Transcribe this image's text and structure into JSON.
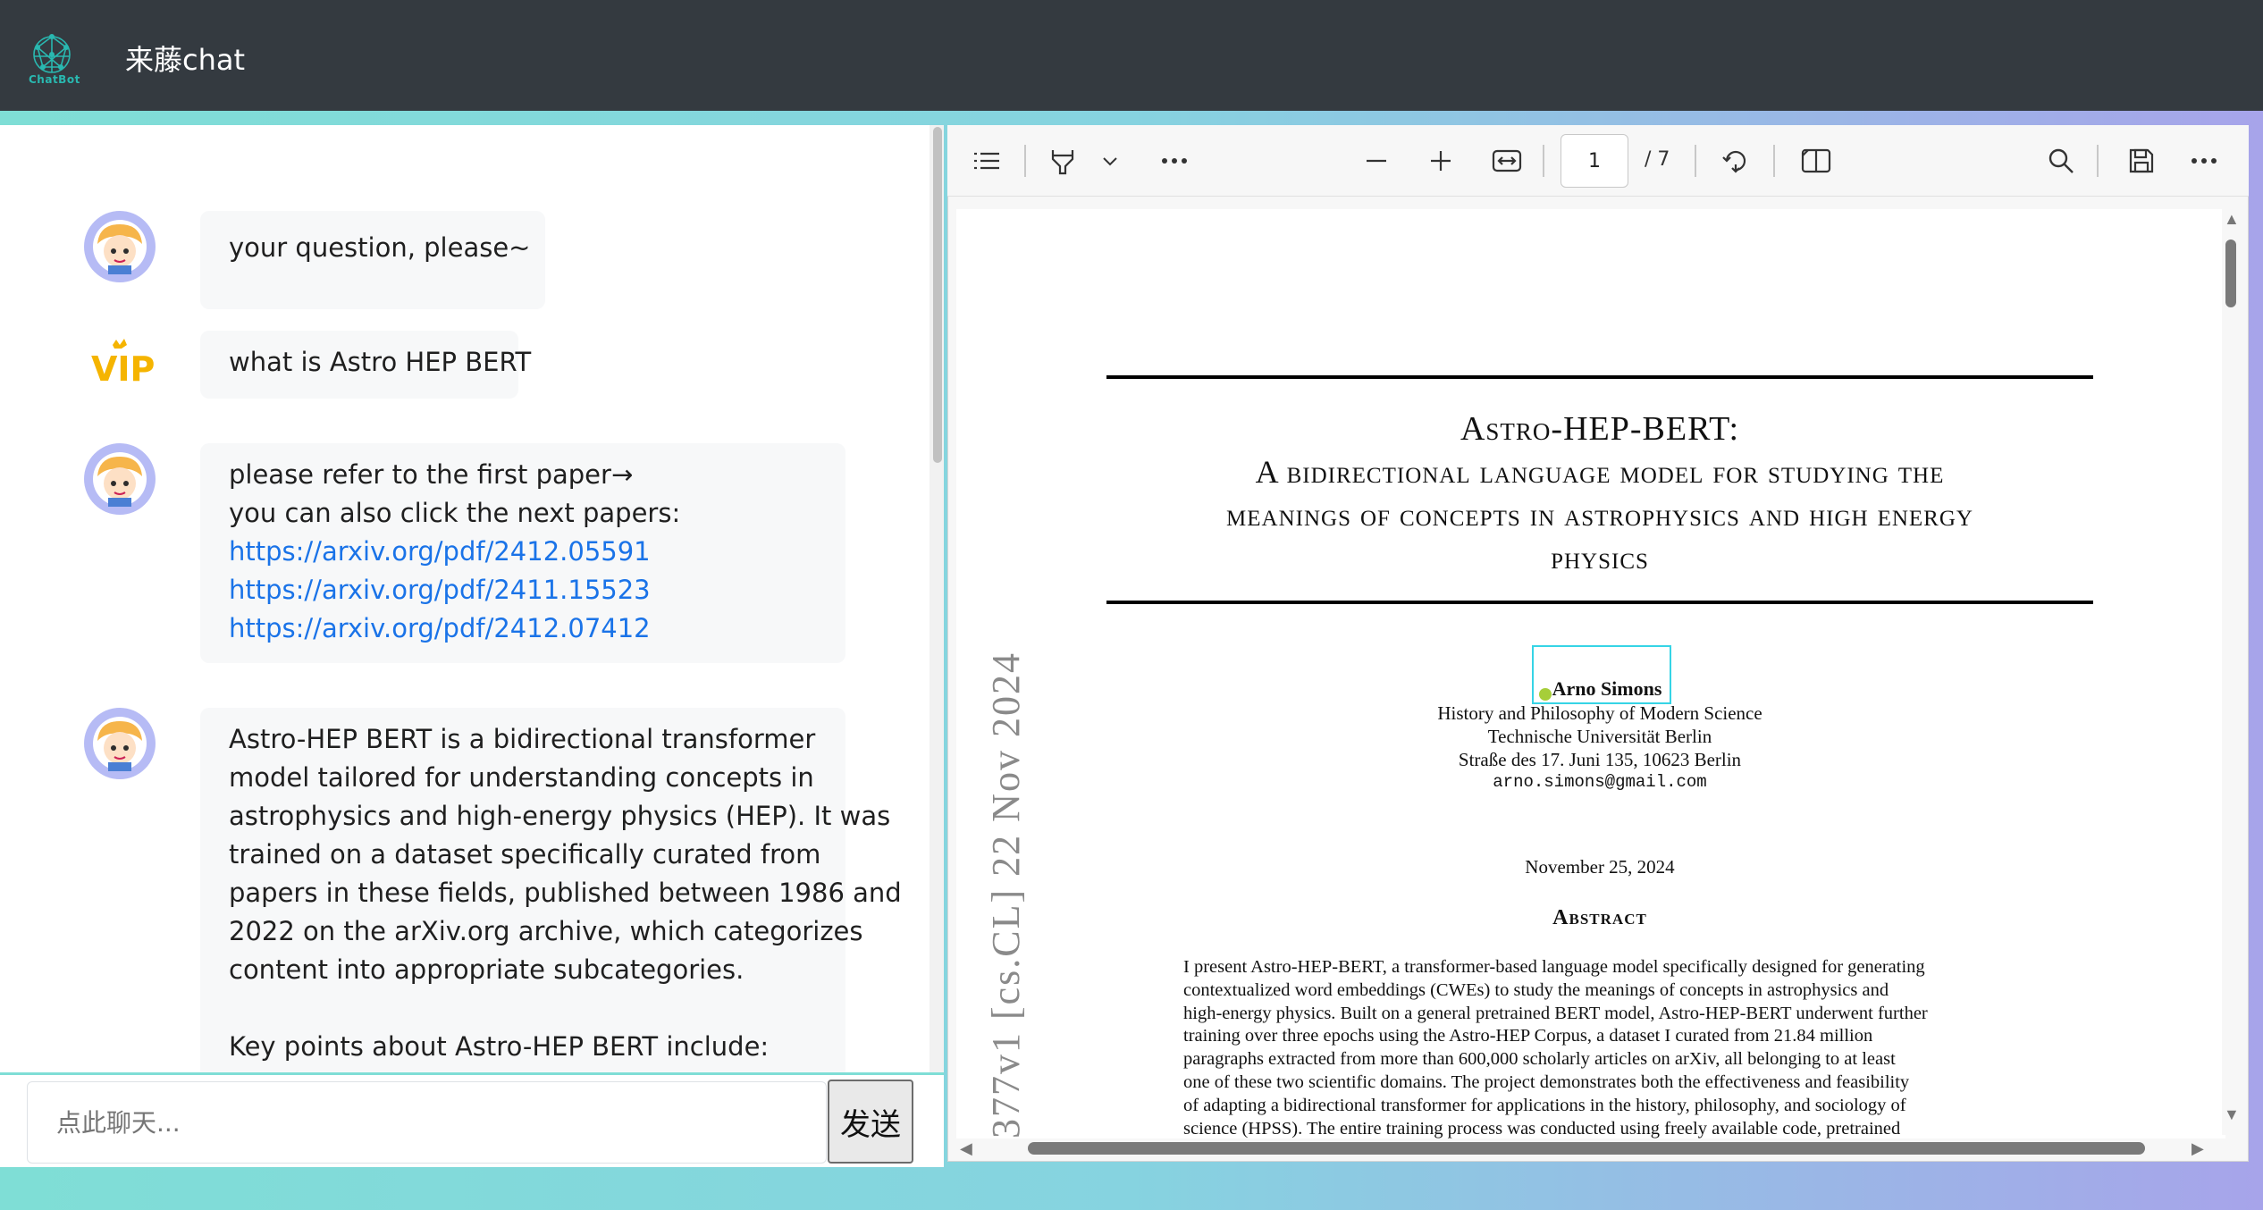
{
  "header": {
    "logo_text": "ChatBot",
    "title": "来藤chat"
  },
  "chat": {
    "messages": [
      {
        "role": "bot",
        "lines": [
          "your question, please~"
        ]
      },
      {
        "role": "user",
        "badge": "VIP",
        "lines": [
          "what is Astro HEP BERT"
        ]
      },
      {
        "role": "bot",
        "lines": [
          "please refer to the first paper→",
          "you can also click the next papers:"
        ],
        "links": [
          "https://arxiv.org/pdf/2412.05591",
          "https://arxiv.org/pdf/2411.15523",
          "https://arxiv.org/pdf/2412.07412"
        ]
      },
      {
        "role": "bot",
        "lines": [
          "Astro-HEP BERT is a bidirectional transformer",
          "model tailored for understanding concepts in",
          "astrophysics and high-energy physics (HEP). It was",
          "trained on a dataset specifically curated from",
          "papers in these fields, published between 1986 and",
          "2022 on the arXiv.org archive, which categorizes",
          "content into appropriate subcategories.",
          "",
          "Key points about Astro-HEP BERT include:"
        ]
      }
    ],
    "input_placeholder": "点此聊天...",
    "send_label": "发送"
  },
  "pdf": {
    "page_number": "1",
    "page_total": "/ 7",
    "icons": [
      "list-icon",
      "highlighter-icon",
      "chevron-down-icon",
      "more-icon",
      "zoom-out-icon",
      "zoom-in-icon",
      "fit-width-icon",
      "rotate-icon",
      "two-page-icon",
      "search-icon",
      "save-icon",
      "more-icon"
    ],
    "page": {
      "title_line1": "Astro-HEP-BERT:",
      "title_line2": "A bidirectional language model for studying the",
      "title_line3": "meanings of concepts in astrophysics and high energy",
      "title_line4": "physics",
      "author": "Arno Simons",
      "affil1": "History and Philosophy of Modern Science",
      "affil2": "Technische Universität Berlin",
      "affil3": "Straße des 17. Juni 135, 10623 Berlin",
      "email": "arno.simons@gmail.com",
      "date": "November 25, 2024",
      "abstract_head": "Abstract",
      "arxiv_stamp": "377v1  [cs.CL]  22 Nov 2024",
      "abstract_lines": [
        "I present Astro-HEP-BERT, a transformer-based language model specifically designed for generating",
        "contextualized word embeddings (CWEs) to study the meanings of concepts in astrophysics and",
        "high-energy physics. Built on a general pretrained BERT model, Astro-HEP-BERT underwent further",
        "training over three epochs using the Astro-HEP Corpus, a dataset I curated from 21.84 million",
        "paragraphs extracted from more than 600,000 scholarly articles on arXiv, all belonging to at least",
        "one of these two scientific domains. The project demonstrates both the effectiveness and feasibility",
        "of adapting a bidirectional transformer for applications in the history, philosophy, and sociology of",
        "science (HPSS). The entire training process was conducted using freely available code, pretrained"
      ]
    }
  }
}
